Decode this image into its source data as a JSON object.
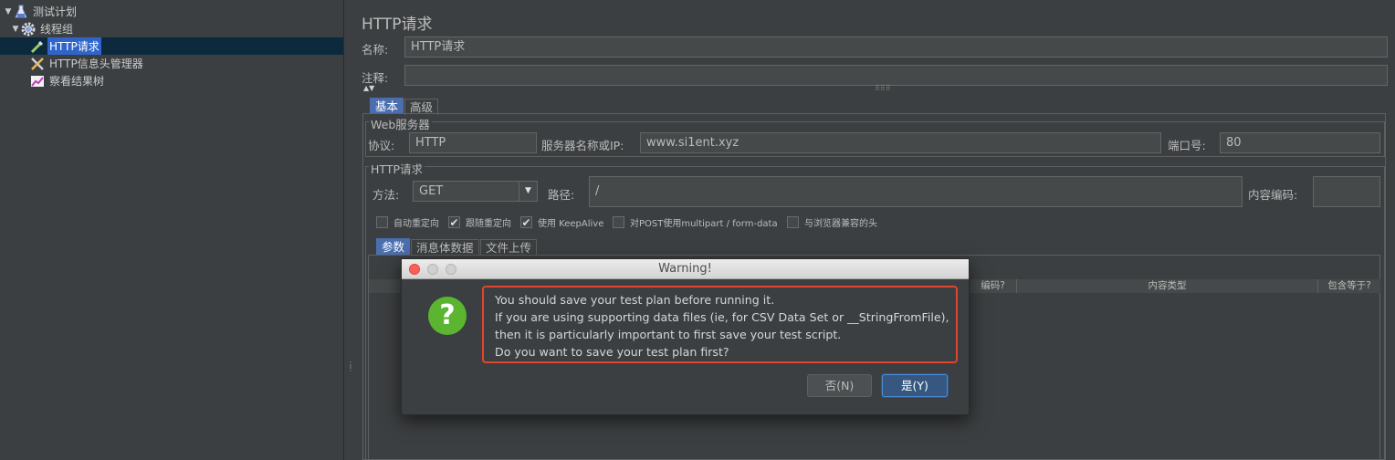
{
  "tree": {
    "items": [
      {
        "label": "测试计划",
        "icon": "flask-icon",
        "expanded": true
      },
      {
        "label": "线程组",
        "icon": "gear-icon",
        "expanded": true
      },
      {
        "label": "HTTP请求",
        "icon": "pipette-icon",
        "selected": true
      },
      {
        "label": "HTTP信息头管理器",
        "icon": "tools-icon"
      },
      {
        "label": "察看结果树",
        "icon": "chart-icon"
      }
    ]
  },
  "panel": {
    "title": "HTTP请求",
    "name_label": "名称:",
    "name_value": "HTTP请求",
    "comment_label": "注释:",
    "comment_value": "",
    "tabs": [
      "基本",
      "高级"
    ],
    "web_server": {
      "title": "Web服务器",
      "protocol_label": "协议:",
      "protocol_value": "HTTP",
      "server_label": "服务器名称或IP:",
      "server_value": "www.si1ent.xyz",
      "port_label": "端口号:",
      "port_value": "80"
    },
    "http_request": {
      "title": "HTTP请求",
      "method_label": "方法:",
      "method_value": "GET",
      "path_label": "路径:",
      "path_value": "/",
      "encoding_label": "内容编码:",
      "encoding_value": ""
    },
    "checkboxes": [
      {
        "label": "自动重定向",
        "checked": false
      },
      {
        "label": "跟随重定向",
        "checked": true
      },
      {
        "label": "使用 KeepAlive",
        "checked": true
      },
      {
        "label": "对POST使用multipart / form-data",
        "checked": false
      },
      {
        "label": "与浏览器兼容的头",
        "checked": false
      }
    ],
    "sub_tabs": [
      "参数",
      "消息体数据",
      "文件上传"
    ],
    "table_headers": [
      "编码?",
      "内容类型",
      "包含等于?"
    ]
  },
  "dialog": {
    "title": "Warning!",
    "message_lines": [
      "You should save your test plan before running it.",
      "If you are using supporting data files (ie, for CSV Data Set or __StringFromFile),",
      "then it is particularly important to first save your test script.",
      "Do you want to save your test plan first?"
    ],
    "no_label": "否(N)",
    "yes_label": "是(Y)",
    "icon": "question-icon",
    "highlight_color": "#e0452e"
  },
  "colors": {
    "background": "#3c3f41",
    "selection": "#2f65ca",
    "accent_button": "#365880"
  }
}
